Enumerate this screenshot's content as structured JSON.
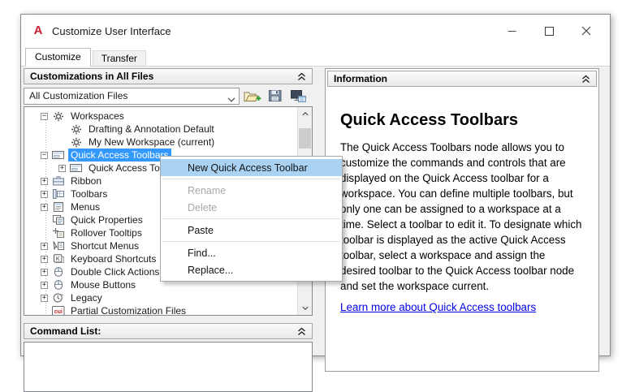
{
  "window": {
    "title": "Customize User Interface",
    "logo_letter": "A"
  },
  "tabs": [
    {
      "label": "Customize",
      "active": true
    },
    {
      "label": "Transfer",
      "active": false
    }
  ],
  "left_panel": {
    "header": "Customizations in All Files",
    "combo_value": "All Customization Files",
    "toolbar_icons": [
      {
        "name": "load-partial-file-icon"
      },
      {
        "name": "save-icon"
      },
      {
        "name": "customize-workspace-icon"
      }
    ],
    "tree": [
      {
        "label": "Workspaces",
        "icon": "gear",
        "expand": "minus",
        "level": 0,
        "selected": false
      },
      {
        "label": "Drafting & Annotation Default",
        "icon": "gear",
        "expand": null,
        "level": 1,
        "selected": false
      },
      {
        "label": "My New Workspace (current)",
        "icon": "gear",
        "expand": null,
        "level": 1,
        "selected": false
      },
      {
        "label": "Quick Access Toolbars",
        "icon": "qat",
        "expand": "minus",
        "level": 0,
        "selected": true
      },
      {
        "label": "Quick Access To",
        "icon": "qat",
        "expand": "plus",
        "level": 1,
        "selected": false
      },
      {
        "label": "Ribbon",
        "icon": "ribbon",
        "expand": "plus",
        "level": 0,
        "selected": false
      },
      {
        "label": "Toolbars",
        "icon": "toolbars",
        "expand": "plus",
        "level": 0,
        "selected": false
      },
      {
        "label": "Menus",
        "icon": "menus",
        "expand": "plus",
        "level": 0,
        "selected": false
      },
      {
        "label": "Quick Properties",
        "icon": "quick-properties",
        "expand": null,
        "level": 0,
        "selected": false
      },
      {
        "label": "Rollover Tooltips",
        "icon": "rollover-tooltips",
        "expand": null,
        "level": 0,
        "selected": false
      },
      {
        "label": "Shortcut Menus",
        "icon": "shortcut-menus",
        "expand": "plus",
        "level": 0,
        "selected": false
      },
      {
        "label": "Keyboard Shortcuts",
        "icon": "keyboard",
        "expand": "plus",
        "level": 0,
        "selected": false
      },
      {
        "label": "Double Click Actions",
        "icon": "mouse",
        "expand": "plus",
        "level": 0,
        "selected": false
      },
      {
        "label": "Mouse Buttons",
        "icon": "mouse",
        "expand": "plus",
        "level": 0,
        "selected": false
      },
      {
        "label": "Legacy",
        "icon": "clock",
        "expand": "plus",
        "level": 0,
        "selected": false
      },
      {
        "label": "Partial Customization Files",
        "icon": "cui-file",
        "expand": null,
        "level": 0,
        "selected": false
      }
    ]
  },
  "command_list": {
    "header": "Command List:"
  },
  "info_panel": {
    "header": "Information",
    "title": "Quick Access Toolbars",
    "body": "The Quick Access Toolbars node allows you to customize the commands and controls that are displayed on the Quick Access toolbar for a workspace. You can define multiple toolbars, but only one can be assigned to a workspace at a time. Select a toolbar to edit it. To designate which toolbar is displayed as the active Quick Access toolbar, select a workspace and assign the desired toolbar to the Quick Access toolbar node and set the workspace current.",
    "link": "Learn more about Quick Access toolbars"
  },
  "context_menu": {
    "items": [
      {
        "label": "New Quick Access Toolbar",
        "state": "highlighted"
      },
      {
        "type": "separator"
      },
      {
        "label": "Rename",
        "state": "disabled"
      },
      {
        "label": "Delete",
        "state": "disabled"
      },
      {
        "type": "separator"
      },
      {
        "label": "Paste",
        "state": "normal"
      },
      {
        "type": "separator"
      },
      {
        "label": "Find...",
        "state": "normal"
      },
      {
        "label": "Replace...",
        "state": "normal"
      }
    ]
  },
  "colors": {
    "tree_selection": "#3399ff",
    "menu_highlight": "#a9d2f3",
    "link": "#0000e6",
    "logo_red": "#c62333"
  }
}
